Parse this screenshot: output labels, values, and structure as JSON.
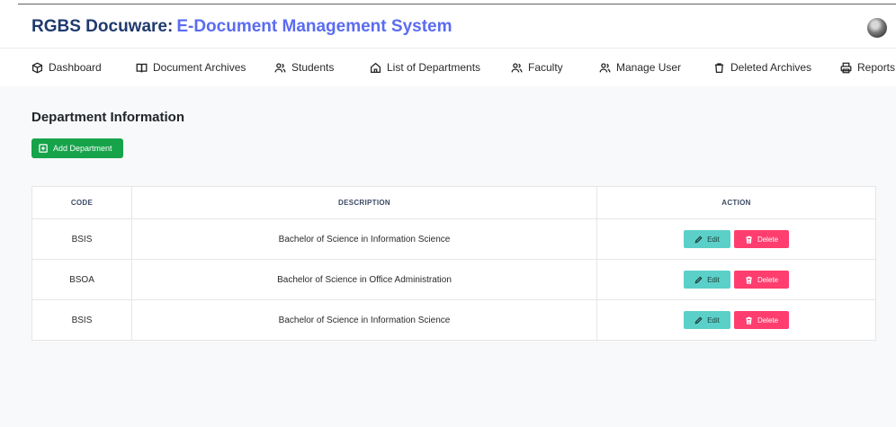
{
  "app": {
    "title_part1": "RGBS Docuware:",
    "title_part2": "E-Document Management System"
  },
  "nav": {
    "items": [
      {
        "label": "Dashboard",
        "icon": "cube-icon"
      },
      {
        "label": "Document Archives",
        "icon": "book-icon"
      },
      {
        "label": "Students",
        "icon": "users-icon"
      },
      {
        "label": "List of Departments",
        "icon": "home-icon"
      },
      {
        "label": "Faculty",
        "icon": "users-icon"
      },
      {
        "label": "Manage User",
        "icon": "users-icon"
      },
      {
        "label": "Deleted Archives",
        "icon": "trash-icon"
      },
      {
        "label": "Reports",
        "icon": "printer-icon"
      }
    ]
  },
  "main": {
    "title": "Department Information",
    "add_button": "Add Department",
    "table": {
      "headers": [
        "CODE",
        "DESCRIPTION",
        "ACTION"
      ],
      "rows": [
        {
          "code": "BSIS",
          "description": "Bachelor of Science in Information Science"
        },
        {
          "code": "BSOA",
          "description": "Bachelor of Science in Office Administration"
        },
        {
          "code": "BSIS",
          "description": "Bachelor of Science in Information Science"
        }
      ],
      "edit_label": "Edit",
      "delete_label": "Delete"
    }
  },
  "colors": {
    "brand_dark": "#1f3a6e",
    "brand_accent": "#5b6cf2",
    "add_button": "#16a34a",
    "edit_button": "#5bd0c9",
    "delete_button": "#ff3d6e"
  }
}
